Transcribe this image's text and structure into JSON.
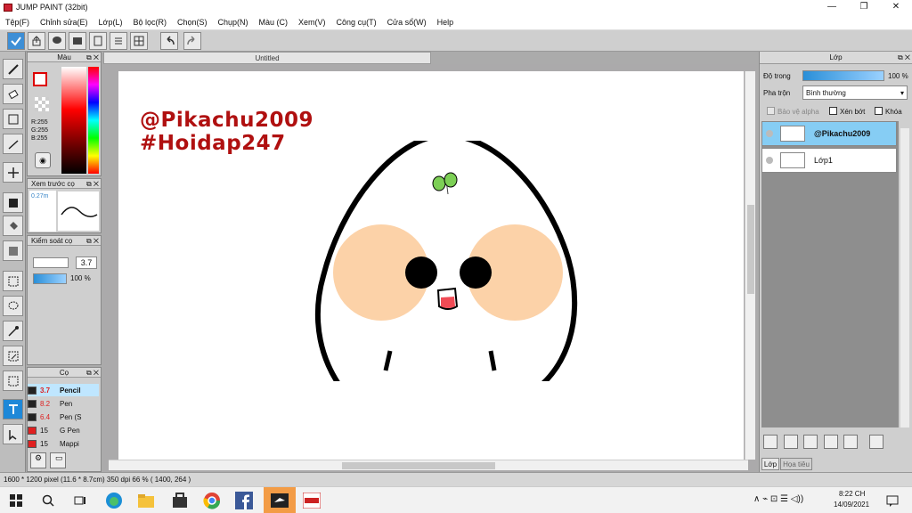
{
  "window": {
    "title": "JUMP PAINT (32bit)",
    "minimize": "—",
    "maximize": "❐",
    "close": "✕"
  },
  "menu": [
    "Tệp(F)",
    "Chỉnh sửa(E)",
    "Lớp(L)",
    "Bộ lọc(R)",
    "Chọn(S)",
    "Chụp(N)",
    "Màu (C)",
    "Xem(V)",
    "Công cụ(T)",
    "Cửa sổ(W)",
    "Help"
  ],
  "document": {
    "tab_title": "Untitled"
  },
  "color_panel": {
    "title": "Màu",
    "r": "R:255",
    "g": "G:255",
    "b": "B:255",
    "fg_color": "#ffffff",
    "bg_color": "#000000"
  },
  "brush_preview": {
    "title": "Xem trước cọ",
    "size": "0.27m"
  },
  "brush_control": {
    "title": "Kiểm soát cọ",
    "size_value": "3.7",
    "opacity_value": "100 %"
  },
  "brush_list": {
    "title": "Cọ",
    "items": [
      {
        "size": "3.7",
        "name": "Pencil",
        "color": "#222222",
        "selected": true
      },
      {
        "size": "8.2",
        "name": "Pen",
        "color": "#222222",
        "selected": false
      },
      {
        "size": "6.4",
        "name": "Pen (S",
        "color": "#222222",
        "selected": false
      },
      {
        "size": "15",
        "name": "G Pen",
        "color": "#e02020",
        "selected": false
      },
      {
        "size": "15",
        "name": "Mappi",
        "color": "#e02020",
        "selected": false
      }
    ]
  },
  "canvas_text": {
    "line1": "@Pikachu2009",
    "line2": "#Hoidap247",
    "text_color": "#b01010"
  },
  "layer_panel": {
    "title": "Lớp",
    "opacity_label": "Độ trong",
    "opacity_value": "100 %",
    "blend_label": "Pha trộn",
    "blend_value": "Bình thường",
    "protect_alpha": "Bảo vệ alpha",
    "clip": "Xén bớt",
    "lock": "Khóa",
    "layers": [
      {
        "name": "@Pikachu2009",
        "selected": true
      },
      {
        "name": "Lớp1",
        "selected": false
      }
    ],
    "tabs": [
      "Lớp",
      "Họa tiêu"
    ]
  },
  "status": {
    "text": "1600 * 1200 pixel   (11.6 * 8.7cm)   350 dpi   66 %   ( 1400, 264 )"
  },
  "taskbar": {
    "time": "8:22 CH",
    "date": "14/09/2021"
  }
}
